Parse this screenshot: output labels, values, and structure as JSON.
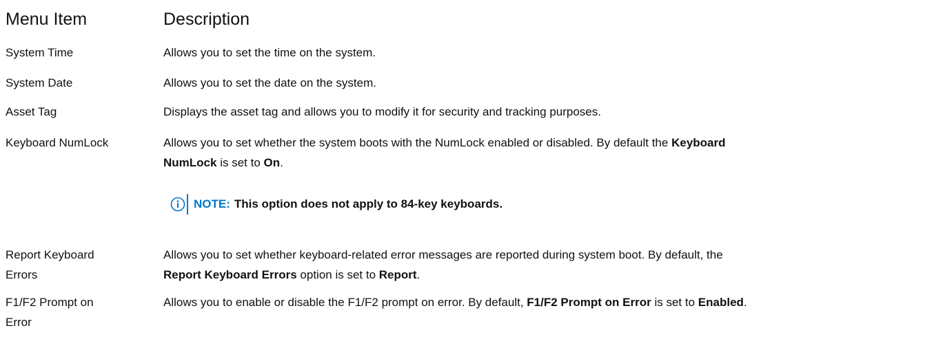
{
  "headers": {
    "menu_item": "Menu Item",
    "description": "Description"
  },
  "rows": [
    {
      "item": "System Time",
      "description": "Allows you to set the time on the system."
    },
    {
      "item": "System Date",
      "description": "Allows you to set the date on the system."
    },
    {
      "item": "Asset Tag",
      "description": "Displays the asset tag and allows you to modify it for security and tracking purposes."
    },
    {
      "item": "Keyboard NumLock",
      "desc_line1": "Allows you to set whether the system boots with the NumLock enabled or disabled. By default the",
      "desc_bold1": "Keyboard",
      "desc_bold2": "NumLock",
      "desc_mid": "is set to",
      "desc_bold3": "On",
      "desc_end": ".",
      "note_label": "NOTE:",
      "note_text": "This option does not apply to 84-key keyboards."
    },
    {
      "item_line1": "Report Keyboard",
      "item_line2": "Errors",
      "desc_line1": "Allows you to set whether keyboard-related error messages are reported during system boot. By default, the",
      "desc_bold1": "Report Keyboard Errors",
      "desc_mid": "option is set to",
      "desc_bold2": "Report",
      "desc_end": "."
    },
    {
      "item_line1": "F1/F2 Prompt on",
      "item_line2": "Error",
      "desc_start": "Allows you to enable or disable the F1/F2 prompt on error. By default,",
      "desc_bold1": "F1/F2 Prompt on Error",
      "desc_mid": "is set to",
      "desc_bold2": "Enabled",
      "desc_end": "."
    }
  ],
  "colors": {
    "note_accent": "#0076ce",
    "text": "#111111"
  },
  "icons": {
    "note": "info-circle-icon"
  }
}
